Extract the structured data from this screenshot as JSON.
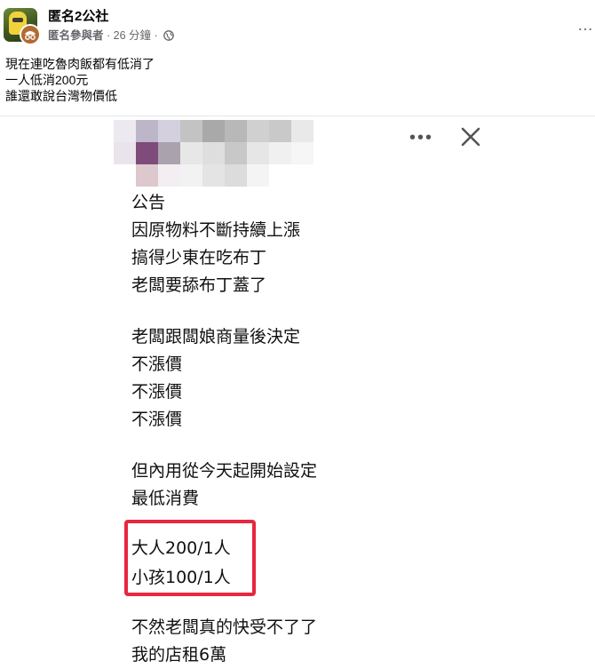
{
  "post": {
    "group_name": "匿名2公社",
    "author": "匿名參與者",
    "separator": " · ",
    "time": "26 分鐘",
    "more_icon": "more-horizontal-icon",
    "privacy_icon": "globe-icon"
  },
  "caption": {
    "lines": [
      "現在連吃魯肉飯都有低消了",
      "一人低消200元",
      "誰還敢說台灣物價低"
    ]
  },
  "screenshot": {
    "close_icon": "close-x-icon",
    "more_icon": "more-horizontal-icon",
    "notice_lines": [
      "公告",
      "因原物料不斷持續上漲",
      "搞得少東在吃布丁",
      "老闆要舔布丁蓋了",
      "老闆跟闆娘商量後決定",
      "不漲價",
      "不漲價",
      "不漲價",
      "但內用從今天起開始設定",
      "最低消費",
      "大人200/1人",
      "小孩100/1人",
      "不然老闆真的快受不了了",
      "我的店租6萬"
    ],
    "highlight_color": "#e8263f"
  }
}
